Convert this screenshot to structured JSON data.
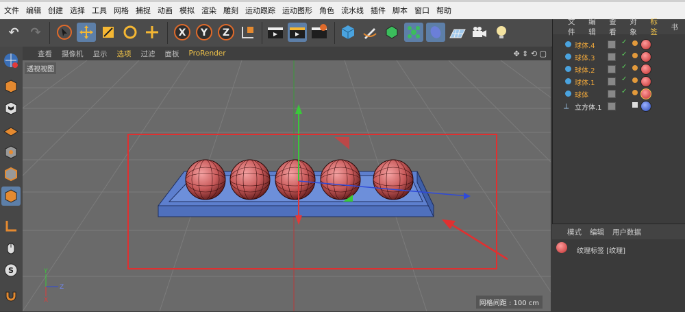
{
  "menu": [
    "文件",
    "编辑",
    "创建",
    "选择",
    "工具",
    "网格",
    "捕捉",
    "动画",
    "模拟",
    "渲染",
    "雕刻",
    "运动跟踪",
    "运动图形",
    "角色",
    "流水线",
    "插件",
    "脚本",
    "窗口",
    "帮助"
  ],
  "toolbar": {
    "axis_x": "X",
    "axis_y": "Y",
    "axis_z": "Z"
  },
  "viewport_menu": [
    "查看",
    "摄像机",
    "显示",
    "选项",
    "过滤",
    "面板",
    "ProRender"
  ],
  "viewport": {
    "label": "透视视图",
    "grid_info": "网格间距 : 100 cm"
  },
  "object_manager": {
    "tabs": [
      "文件",
      "编辑",
      "查看",
      "对象",
      "标签",
      "书"
    ],
    "objects": [
      {
        "name": "球体.4"
      },
      {
        "name": "球体.3"
      },
      {
        "name": "球体.2"
      },
      {
        "name": "球体.1"
      },
      {
        "name": "球体"
      },
      {
        "name": "立方体.1"
      }
    ]
  },
  "attribute_manager": {
    "tabs": [
      "模式",
      "编辑",
      "用户数据"
    ],
    "title": "纹理标签 [纹理]"
  },
  "axis_gizmo": {
    "x": "X",
    "y": "Y",
    "z": "Z"
  },
  "colors": {
    "selection_frame": "#e03030",
    "viewport_bg": "#6a6a6a",
    "accent": "#f2c44a"
  }
}
